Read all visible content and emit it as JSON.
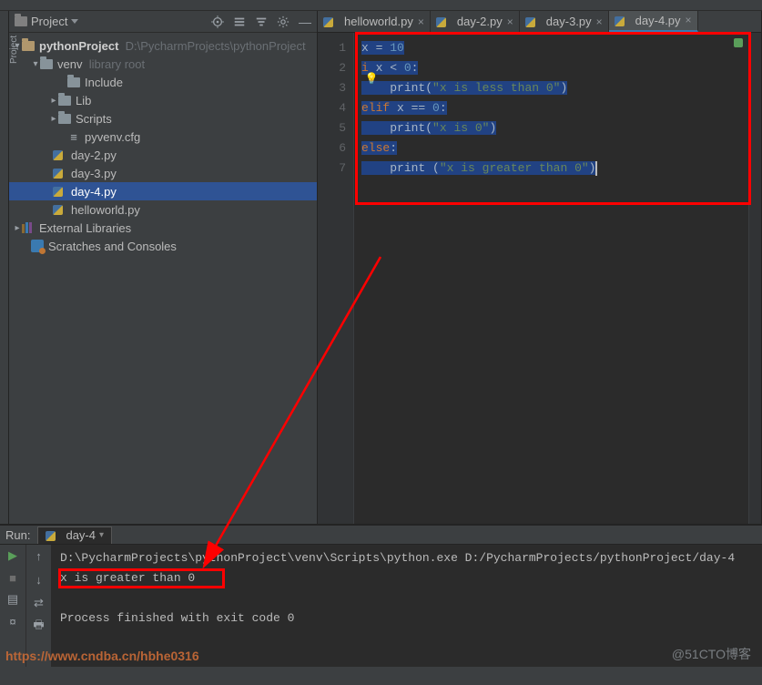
{
  "panel": {
    "title": "Project"
  },
  "tree": {
    "root": {
      "name": "pythonProject",
      "hint": "D:\\PycharmProjects\\pythonProject"
    },
    "venv": {
      "name": "venv",
      "hint": "library root"
    },
    "include": "Include",
    "lib": "Lib",
    "scripts": "Scripts",
    "pyvenv": "pyvenv.cfg",
    "day2": "day-2.py",
    "day3": "day-3.py",
    "day4": "day-4.py",
    "hello": "helloworld.py",
    "ext": "External Libraries",
    "scratch": "Scratches and Consoles"
  },
  "tabs": {
    "t1": "helloworld.py",
    "t2": "day-2.py",
    "t3": "day-3.py",
    "t4": "day-4.py"
  },
  "code": {
    "l1": {
      "a": "x",
      "b": " = ",
      "c": "10"
    },
    "l2": {
      "a": "i",
      "b": " x < ",
      "c": "0",
      "d": ":"
    },
    "bulbChar": "💡",
    "l3": {
      "a": "print",
      "b": "(",
      "c": "\"x is less than 0\"",
      "d": ")"
    },
    "l4": {
      "a": "elif",
      "b": " x == ",
      "c": "0",
      "d": ":"
    },
    "l5": {
      "a": "print",
      "b": "(",
      "c": "\"x is 0\"",
      "d": ")"
    },
    "l6": {
      "a": "else",
      "b": ":"
    },
    "l7": {
      "a": "print ",
      "b": "(",
      "c": "\"x is greater than 0\"",
      "d": ")"
    }
  },
  "gutter": {
    "n1": "1",
    "n2": "2",
    "n3": "3",
    "n4": "4",
    "n5": "5",
    "n6": "6",
    "n7": "7"
  },
  "run": {
    "label": "Run:",
    "tab": "day-4",
    "cmd": "D:\\PycharmProjects\\pythonProject\\venv\\Scripts\\python.exe D:/PycharmProjects/pythonProject/day-4",
    "out": "x is greater than 0",
    "done": "Process finished with exit code 0"
  },
  "watermark": {
    "left": "https://www.cndba.cn/hbhe0316",
    "right": "@51CTO博客"
  }
}
